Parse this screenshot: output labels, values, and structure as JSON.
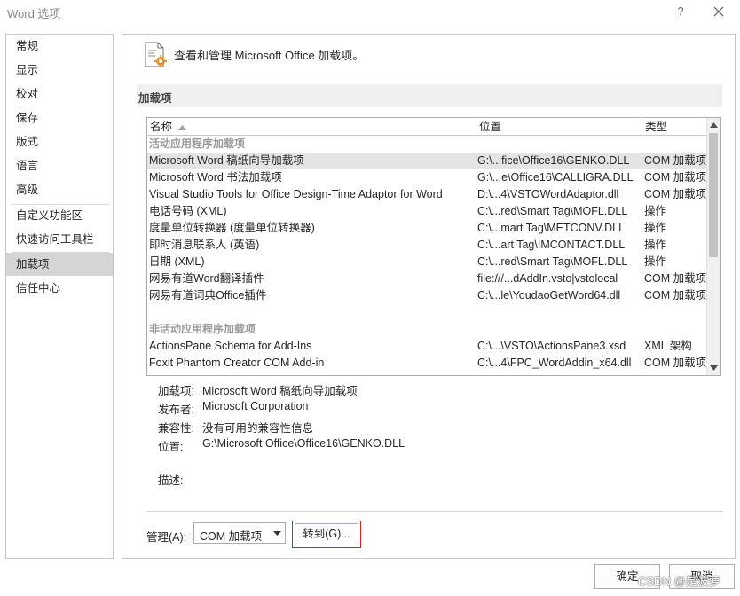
{
  "window": {
    "title": "Word 选项",
    "help": "?"
  },
  "nav": {
    "items": [
      {
        "label": "常规"
      },
      {
        "label": "显示"
      },
      {
        "label": "校对"
      },
      {
        "label": "保存"
      },
      {
        "label": "版式"
      },
      {
        "label": "语言"
      },
      {
        "label": "高级"
      },
      {
        "label": "自定义功能区"
      },
      {
        "label": "快速访问工具栏"
      },
      {
        "label": "加载项"
      },
      {
        "label": "信任中心"
      }
    ],
    "active": "加载项"
  },
  "main": {
    "header": "查看和管理 Microsoft Office 加载项。",
    "section": "加载项",
    "columns": {
      "name": "名称",
      "location": "位置",
      "type": "类型"
    },
    "groups": {
      "active": "活动应用程序加载项",
      "inactive": "非活动应用程序加载项"
    },
    "active_rows": [
      {
        "name": "Microsoft Word 稿纸向导加载项",
        "location": "G:\\...fice\\Office16\\GENKO.DLL",
        "type": "COM 加载项"
      },
      {
        "name": "Microsoft Word 书法加载项",
        "location": "G:\\...e\\Office16\\CALLIGRA.DLL",
        "type": "COM 加载项"
      },
      {
        "name": "Visual Studio Tools for Office Design-Time Adaptor for Word",
        "location": "D:\\...4\\VSTOWordAdaptor.dll",
        "type": "COM 加载项"
      },
      {
        "name": "电话号码 (XML)",
        "location": "C:\\...red\\Smart Tag\\MOFL.DLL",
        "type": "操作"
      },
      {
        "name": "度量单位转换器 (度量单位转换器)",
        "location": "C:\\...mart Tag\\METCONV.DLL",
        "type": "操作"
      },
      {
        "name": "即时消息联系人 (英语)",
        "location": "C:\\...art Tag\\IMCONTACT.DLL",
        "type": "操作"
      },
      {
        "name": "日期 (XML)",
        "location": "C:\\...red\\Smart Tag\\MOFL.DLL",
        "type": "操作"
      },
      {
        "name": "网易有道Word翻译插件",
        "location": "file:///...dAddIn.vsto|vstolocal",
        "type": "COM 加载项"
      },
      {
        "name": "网易有道词典Office插件",
        "location": "C:\\...le\\YoudaoGetWord64.dll",
        "type": "COM 加载项"
      }
    ],
    "inactive_rows": [
      {
        "name": "ActionsPane Schema for Add-Ins",
        "location": "C:\\...\\VSTO\\ActionsPane3.xsd",
        "type": "XML 架构"
      },
      {
        "name": "Foxit Phantom Creator COM Add-in",
        "location": "C:\\...4\\FPC_WordAddin_x64.dll",
        "type": "COM 加载项"
      }
    ],
    "details": {
      "addin_label": "加载项:",
      "addin": "Microsoft Word 稿纸向导加载项",
      "publisher_label": "发布者:",
      "publisher": "Microsoft Corporation",
      "compat_label": "兼容性:",
      "compat": "没有可用的兼容性信息",
      "location_label": "位置:",
      "location": "G:\\Microsoft Office\\Office16\\GENKO.DLL",
      "desc_label": "描述:"
    },
    "manage": {
      "label": "管理(A):",
      "value": "COM 加载项",
      "go": "转到(G)..."
    }
  },
  "footer": {
    "ok": "确定",
    "cancel": "取消",
    "watermark": "CSDN @是波萝"
  },
  "colors": {
    "selected_row": "#e4e4e4",
    "active_nav": "#d5d5d5",
    "goto_border": "#c42b2b",
    "icon_accent": "#e8912e"
  }
}
